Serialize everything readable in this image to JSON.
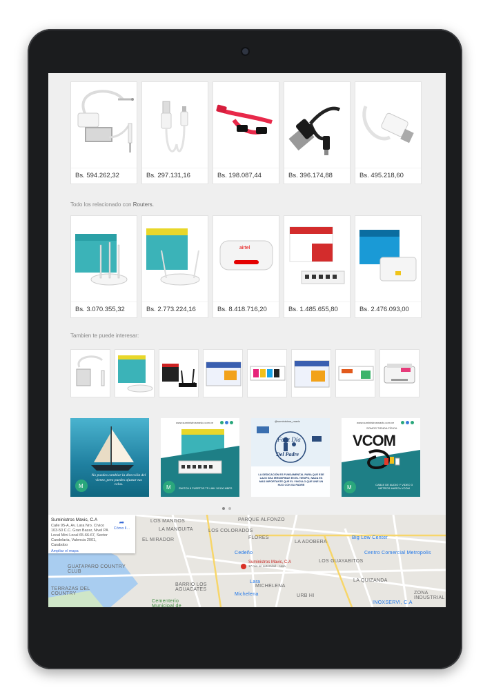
{
  "row1": {
    "prices": [
      "Bs. 594.262,32",
      "Bs. 297.131,16",
      "Bs. 198.087,44",
      "Bs. 396.174,88",
      "Bs. 495.218,60"
    ]
  },
  "row2": {
    "label_prefix": "Todo los relacionado con",
    "label_category": "Routers.",
    "prices": [
      "Bs. 3.070.355,32",
      "Bs. 2.773.224,16",
      "Bs. 8.418.716,20",
      "Bs. 1.485.655,80",
      "Bs. 2.476.093,00"
    ]
  },
  "interest": {
    "label": "Tambien te puede interesar:"
  },
  "banners": {
    "sail_text": "No puedes cambiar la dirección del viento, pero puedes ajustar tus velas.",
    "switch_url": "www.suministrosmavic.com.ve",
    "switch_caption": "SWITCH 8 PUERTOS TP-LINK 10/100 MBPS",
    "father_handle": "@suministros_mavic",
    "father_title_1": "Feliz Día",
    "father_title_2": "Del Padre",
    "father_text": "LA DEDICACIÓN ES FUNDAMENTAL PARA QUE ESE LAZO SEA IRROMPIBLE EN EL TIEMPO, NADA ES MAS IMPORTANTE QUE EL VINCULO QUE UNE UN HIJO CON SU PADRE",
    "vcom_url": "www.suministrosmavic.com.ve",
    "vcom_store": "SOMOS TIENDA FÍSICA",
    "vcom_brand": "VCOM",
    "vcom_caption": "CABLE DE AUDIO Y VIDEO 3 METROS MARCA VCOM"
  },
  "map": {
    "info_name": "Suministros Mavic, C.A",
    "info_address": "Calle 95-A, Av. Lara Nro. Cívico 103-50 C.C. Gran Bazar, Nivel PA Local Mini Local 65-66-67, Sector Candelaria, Valencia 2001, Carabobo",
    "info_directions": "Cómo ll...",
    "info_link": "Ampliar el mapa",
    "pin_label": "Suministros Mavic, C.A",
    "pin_sub": "17 min en automóvil · casa",
    "labels": [
      "LOS MANGOS",
      "PARQUE ALFONZO",
      "LA MANGUITA",
      "EL MIRADOR",
      "LOS COLORADOS",
      "FLORES",
      "LA ADOBERA",
      "Big Low Center",
      "Centro Comercial Metropolis",
      "GUATAPARO COUNTRY CLUB",
      "LOS GUAYABITOS",
      "LA QUIZANDA",
      "TERRAZAS DEL COUNTRY",
      "BARRIO LOS AGUACATES",
      "MICHELENA",
      "URB HI",
      "ZONA INDUSTRIAL",
      "INOXSERVI, C.A",
      "Cementerio Municipal de Valencia",
      "Cedeño",
      "Lara",
      "Michelena"
    ]
  }
}
